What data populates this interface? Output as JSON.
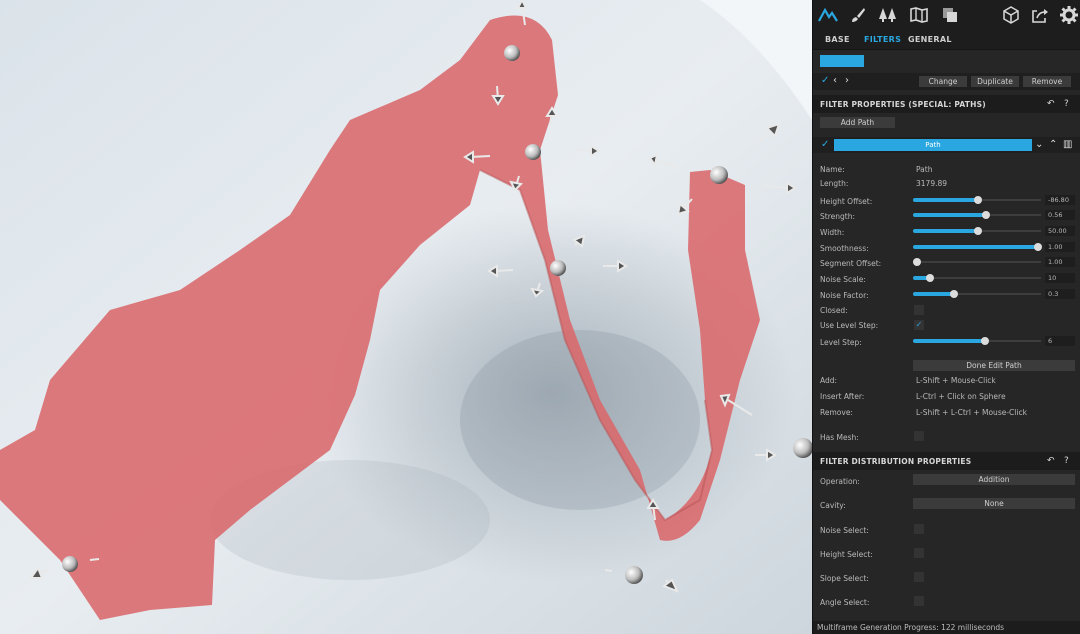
{
  "toolbar": {
    "icons": [
      "mountain-logo-icon",
      "brush-icon",
      "trees-icon",
      "map-icon",
      "layers-icon",
      "cube-icon",
      "export-icon",
      "gear-icon"
    ]
  },
  "tabs": [
    {
      "label": "BASE"
    },
    {
      "label": "FILTERS",
      "active": true
    },
    {
      "label": "GENERAL"
    }
  ],
  "nav": {
    "check": "✓",
    "prev": "‹",
    "next": "›",
    "change": "Change",
    "duplicate": "Duplicate",
    "remove": "Remove"
  },
  "filter_properties": {
    "title": "FILTER PROPERTIES (SPECIAL: PATHS)",
    "add_path": "Add Path",
    "path_check": "✓",
    "path_label": "Path",
    "name_label": "Name:",
    "name_value": "Path",
    "length_label": "Length:",
    "length_value": "3179.89",
    "sliders": [
      {
        "label": "Height Offset:",
        "value": "-86.80",
        "fraction": 0.51
      },
      {
        "label": "Strength:",
        "value": "0.56",
        "fraction": 0.57
      },
      {
        "label": "Width:",
        "value": "50.00",
        "fraction": 0.51
      },
      {
        "label": "Smoothness:",
        "value": "1.00",
        "fraction": 0.98
      },
      {
        "label": "Segment Offset:",
        "value": "1.00",
        "fraction": 0.03
      },
      {
        "label": "Noise Scale:",
        "value": "10",
        "fraction": 0.13
      },
      {
        "label": "Noise Factor:",
        "value": "0.3",
        "fraction": 0.32
      }
    ],
    "closed_label": "Closed:",
    "use_level_step_label": "Use Level Step:",
    "use_level_step_check": "✓",
    "level_step": {
      "label": "Level Step:",
      "value": "6",
      "fraction": 0.56
    },
    "done_edit_path": "Done Edit Path",
    "add_label": "Add:",
    "add_hint": "L-Shift + Mouse-Click",
    "insert_label": "Insert After:",
    "insert_hint": "L-Ctrl + Click on Sphere",
    "remove_label": "Remove:",
    "remove_hint": "L-Shift + L-Ctrl + Mouse-Click",
    "has_mesh_label": "Has Mesh:"
  },
  "distribution": {
    "title": "FILTER DISTRIBUTION PROPERTIES",
    "operation_label": "Operation:",
    "operation_value": "Addition",
    "cavity_label": "Cavity:",
    "cavity_value": "None",
    "noise_select": "Noise Select:",
    "height_select": "Height Select:",
    "slope_select": "Slope Select:",
    "angle_select": "Angle Select:"
  },
  "status": {
    "text": "Multiframe Generation Progress: 122 milliseconds"
  },
  "colors": {
    "accent": "#2aa7e0",
    "path_fill": "#d9686b",
    "terrain": "#e3e9ee"
  }
}
